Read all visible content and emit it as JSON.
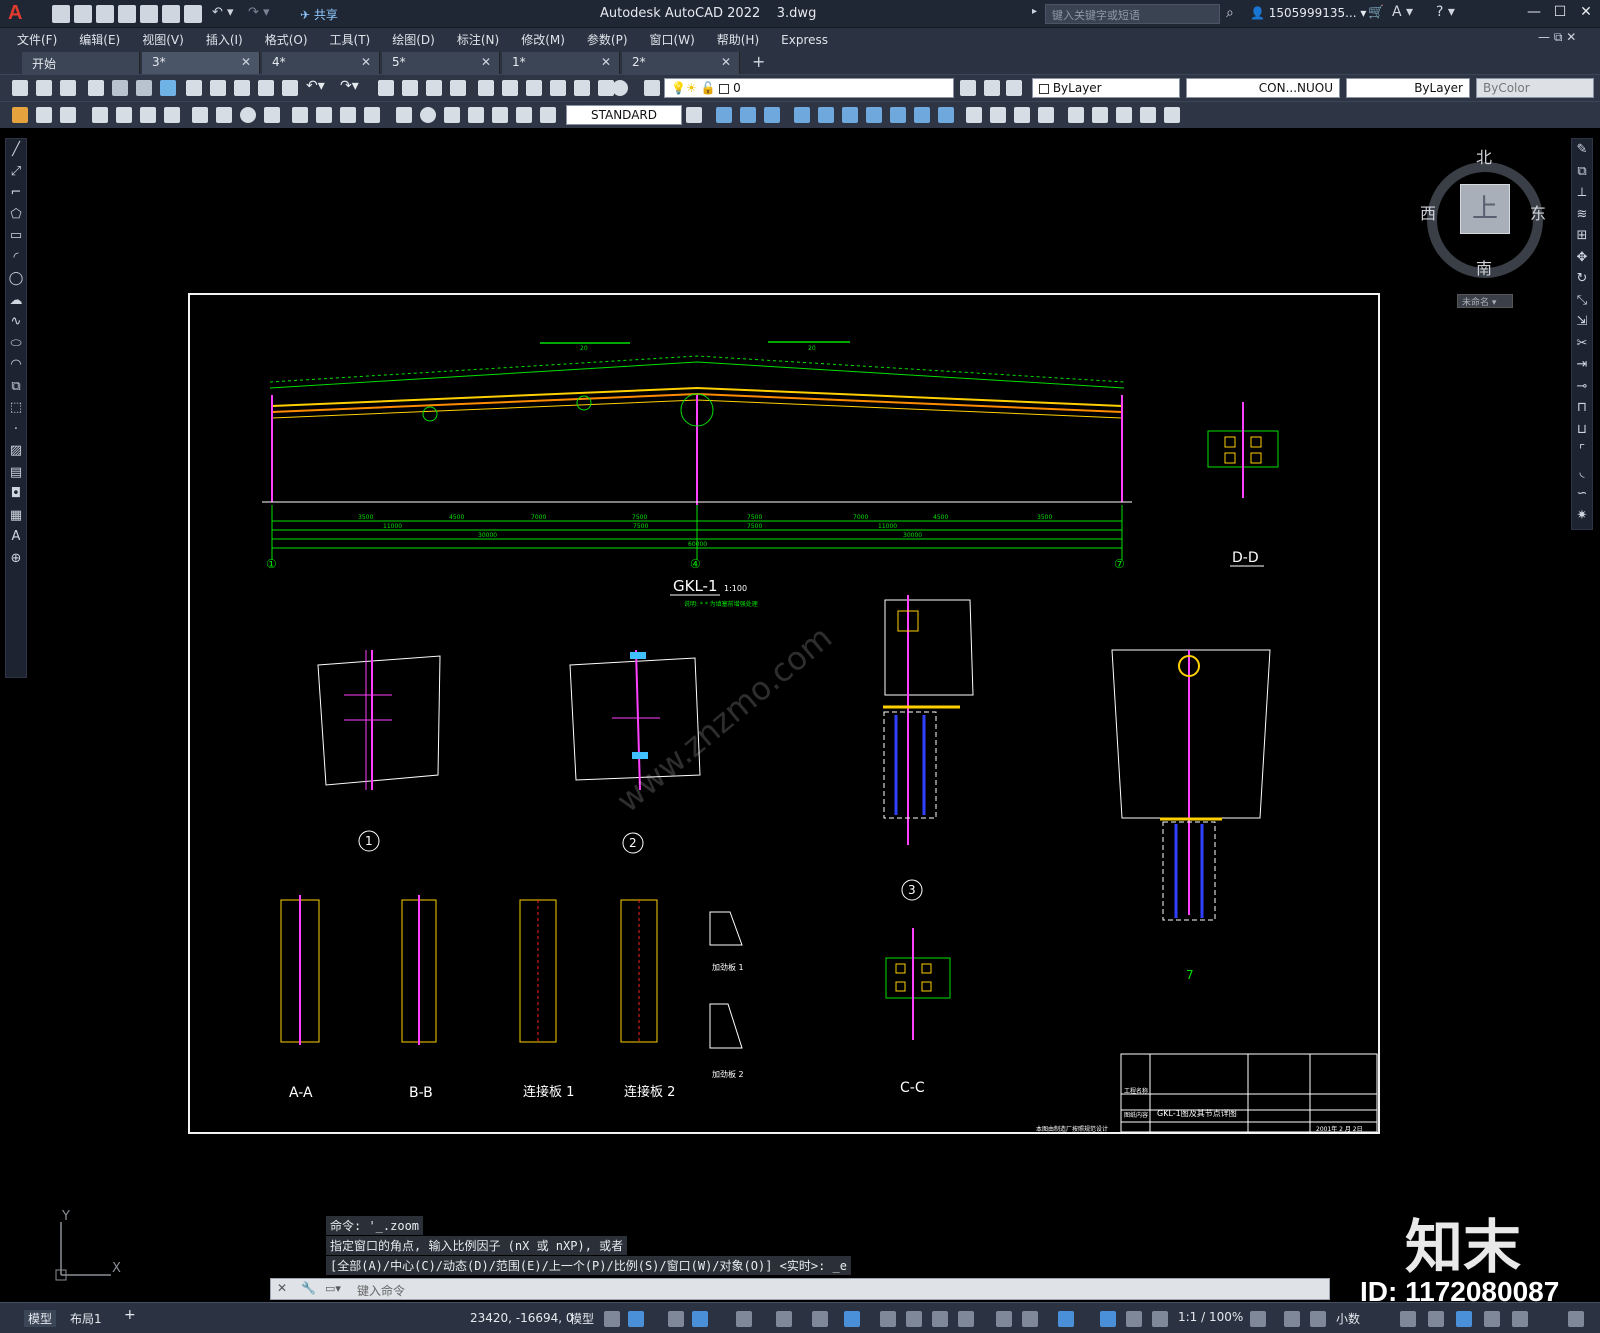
{
  "app": {
    "title": "Autodesk AutoCAD 2022",
    "file": "3.dwg",
    "share": "共享",
    "search_placeholder": "键入关键字或短语",
    "user": "1505999135..."
  },
  "menu": [
    "文件(F)",
    "编辑(E)",
    "视图(V)",
    "插入(I)",
    "格式(O)",
    "工具(T)",
    "绘图(D)",
    "标注(N)",
    "修改(M)",
    "参数(P)",
    "窗口(W)",
    "帮助(H)",
    "Express"
  ],
  "tabs": [
    {
      "label": "开始",
      "active": false,
      "closable": false
    },
    {
      "label": "3*",
      "active": true,
      "closable": true
    },
    {
      "label": "4*",
      "active": false,
      "closable": true
    },
    {
      "label": "5*",
      "active": false,
      "closable": true
    },
    {
      "label": "1*",
      "active": false,
      "closable": true
    },
    {
      "label": "2*",
      "active": false,
      "closable": true
    }
  ],
  "toolbar": {
    "layer_value": "0",
    "color": "ByLayer",
    "linetype": "CON...NUOU",
    "lineweight": "ByLayer",
    "plotstyle": "ByColor",
    "textstyle": "STANDARD"
  },
  "viewcube": {
    "north": "北",
    "south": "南",
    "east": "东",
    "west": "西",
    "top": "上",
    "ucs": "未命名"
  },
  "drawing": {
    "main_title": "GKL-1",
    "main_scale": "1:100",
    "main_note": "说明: * * 为填塞前增强处理",
    "axis_labels": [
      "①",
      "④",
      "⑦"
    ],
    "top_dims": [
      "20",
      "20"
    ],
    "bottom_dims": [
      "3500",
      "4500",
      "7000",
      "7500",
      "7500",
      "7000",
      "4500",
      "3500"
    ],
    "mid_dims": [
      "11000",
      "7500",
      "7500",
      "11000"
    ],
    "half_dims": [
      "30000",
      "30000"
    ],
    "total_dim": "60000",
    "detail_labels": [
      "1",
      "2",
      "3",
      "7"
    ],
    "section_labels": [
      "A-A",
      "B-B",
      "连接板 1",
      "连接板 2",
      "C-C",
      "D-D"
    ],
    "stiffener_labels": [
      "加劲板 1",
      "加劲板 2"
    ],
    "titleblock": {
      "drawing_name": "GKL-1图及其节点详图",
      "footer_left": "本图由制造厂按照规范设计",
      "date": "2001年 2 月 2日",
      "project_label": "工程名称",
      "name_label": "图纸内容"
    }
  },
  "command": {
    "line1": "命令: '_.zoom",
    "line2": "指定窗口的角点, 输入比例因子 (nX 或 nXP), 或者",
    "line3": "[全部(A)/中心(C)/动态(D)/范围(E)/上一个(P)/比例(S)/窗口(W)/对象(O)] <实时>: _e",
    "placeholder": "键入命令"
  },
  "status": {
    "model_tab": "模型",
    "layout_tab": "布局1",
    "coords": "23420, -16694, 0",
    "mode": "模型",
    "scale": "1:1 / 100%",
    "units": "小数"
  },
  "watermark": {
    "brand": "知末",
    "id": "ID: 1172080087",
    "url": "www.znzmo.com"
  }
}
